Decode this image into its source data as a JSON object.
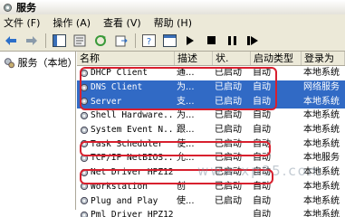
{
  "window": {
    "title": "服务"
  },
  "menu": [
    "文件 (F)",
    "操作 (A)",
    "查看 (V)",
    "帮助 (H)"
  ],
  "toolbar": [
    "back-icon",
    "forward-icon",
    "show-hide-tree-icon",
    "properties-icon",
    "refresh-icon",
    "export-list-icon",
    "help-icon",
    "console-icon",
    "play-icon",
    "stop-icon",
    "pause-icon",
    "restart-icon"
  ],
  "tree": {
    "label": "服务（本地）"
  },
  "columns": [
    "名称",
    "描述",
    "状.",
    "启动类型",
    "登录为"
  ],
  "rows": [
    {
      "name": "DHCP Client",
      "desc": "通...",
      "status": "已启动",
      "startup": "自动",
      "logon": "本地系统",
      "selected": false
    },
    {
      "name": "DNS Client",
      "desc": "为...",
      "status": "已启动",
      "startup": "自动",
      "logon": "网络服务",
      "selected": true
    },
    {
      "name": "Server",
      "desc": "支...",
      "status": "已启动",
      "startup": "自动",
      "logon": "本地系统",
      "selected": true
    },
    {
      "name": "Shell Hardware...",
      "desc": "为...",
      "status": "已启动",
      "startup": "自动",
      "logon": "本地系统",
      "selected": false
    },
    {
      "name": "System Event N...",
      "desc": "跟...",
      "status": "已启动",
      "startup": "自动",
      "logon": "本地系统",
      "selected": false
    },
    {
      "name": "Task Scheduler",
      "desc": "使...",
      "status": "已启动",
      "startup": "自动",
      "logon": "本地系统",
      "selected": false
    },
    {
      "name": "TCP/IP NetBIOS...",
      "desc": "允...",
      "status": "已启动",
      "startup": "自动",
      "logon": "本地服务",
      "selected": false
    },
    {
      "name": "Net Driver HPZ12",
      "desc": "",
      "status": "已启动",
      "startup": "自动",
      "logon": "本地系统",
      "selected": false
    },
    {
      "name": "Workstation",
      "desc": "创",
      "status": "已启动",
      "startup": "自动",
      "logon": "本地系统",
      "selected": false
    },
    {
      "name": "Plug and Play",
      "desc": "使...",
      "status": "已启动",
      "startup": "自动",
      "logon": "本地系统",
      "selected": false
    },
    {
      "name": "Pml Driver HPZ12",
      "desc": "",
      "status": "",
      "startup": "自动",
      "logon": "本地系统",
      "selected": false
    }
  ],
  "watermark": "www.xp85.com",
  "colors": {
    "selection": "#316ac5",
    "highlight_ring": "#d8202e"
  }
}
